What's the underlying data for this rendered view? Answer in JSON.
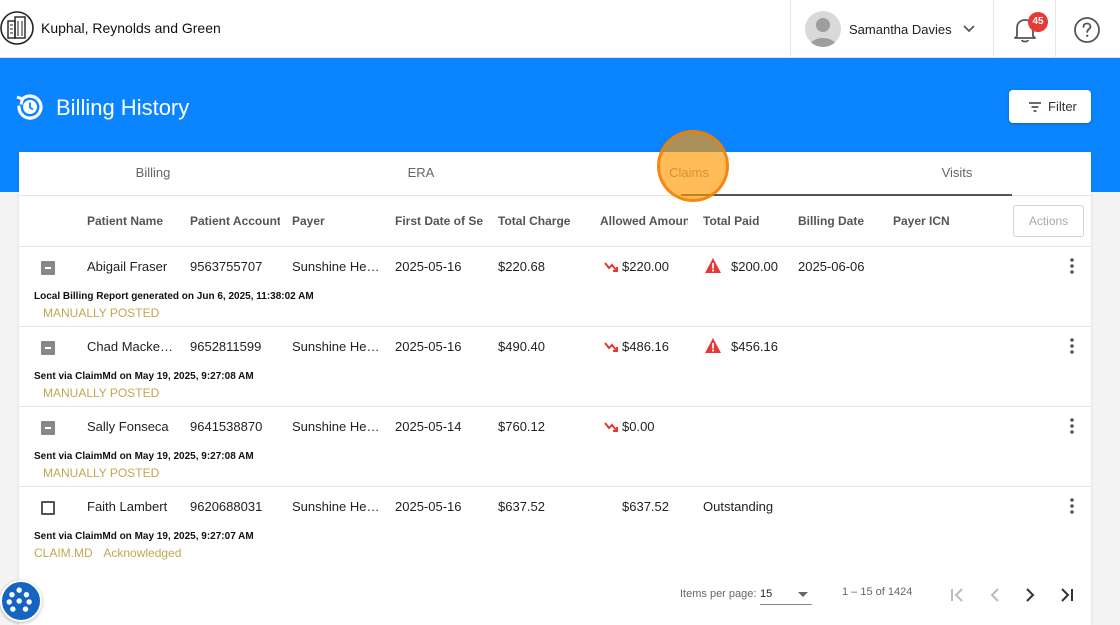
{
  "header": {
    "org_name": "Kuphal, Reynolds and Green",
    "user_name": "Samantha Davies",
    "notification_count": "45"
  },
  "banner": {
    "title": "Billing History",
    "filter_label": "Filter"
  },
  "tabs": [
    {
      "label": "Billing",
      "active": false
    },
    {
      "label": "ERA",
      "active": false
    },
    {
      "label": "Claims",
      "active": true
    },
    {
      "label": "Visits",
      "active": false
    }
  ],
  "table": {
    "columns": [
      "Patient Name",
      "Patient Account",
      "Payer",
      "First Date of Service",
      "Total Charge",
      "Allowed Amount",
      "Total Paid",
      "Billing Date",
      "Payer ICN"
    ],
    "actions_label": "Actions",
    "rows": [
      {
        "checkbox": "indeterminate",
        "patient_name": "Abigail Fraser",
        "patient_account": "9563755707",
        "payer": "Sunshine Health Plan",
        "first_date": "2025-05-16",
        "total_charge": "$220.68",
        "allowed": "$220.00",
        "allowed_trend": "down",
        "total_paid": "$200.00",
        "paid_warning": true,
        "billing_date": "2025-06-06",
        "payer_icn": "",
        "meta": "Local Billing Report generated on Jun 6, 2025, 11:38:02 AM",
        "statuses": [
          "MANUALLY POSTED"
        ]
      },
      {
        "checkbox": "indeterminate",
        "patient_name": "Chad Mackenzie",
        "patient_account": "9652811599",
        "payer": "Sunshine Health Plan",
        "first_date": "2025-05-16",
        "total_charge": "$490.40",
        "allowed": "$486.16",
        "allowed_trend": "down",
        "total_paid": "$456.16",
        "paid_warning": true,
        "billing_date": "",
        "payer_icn": "",
        "meta": "Sent via ClaimMd on May 19, 2025, 9:27:08 AM",
        "statuses": [
          "MANUALLY POSTED"
        ]
      },
      {
        "checkbox": "indeterminate",
        "patient_name": "Sally Fonseca",
        "patient_account": "9641538870",
        "payer": "Sunshine Health Plan",
        "first_date": "2025-05-14",
        "total_charge": "$760.12",
        "allowed": "$0.00",
        "allowed_trend": "down",
        "total_paid": "",
        "paid_warning": false,
        "billing_date": "",
        "payer_icn": "",
        "meta": "Sent via ClaimMd on May 19, 2025, 9:27:08 AM",
        "statuses": [
          "MANUALLY POSTED"
        ]
      },
      {
        "checkbox": "unchecked",
        "patient_name": "Faith Lambert",
        "patient_account": "9620688031",
        "payer": "Sunshine Health Plan",
        "first_date": "2025-05-16",
        "total_charge": "$637.52",
        "allowed": "$637.52",
        "allowed_trend": "",
        "total_paid": "Outstanding",
        "paid_warning": false,
        "billing_date": "",
        "payer_icn": "",
        "meta": "Sent via ClaimMd on May 19, 2025, 9:27:07 AM",
        "statuses": [
          "CLAIM.MD",
          "Acknowledged"
        ]
      }
    ]
  },
  "paginator": {
    "items_label": "Items per page:",
    "page_size": "15",
    "range": "1 – 15 of 1424"
  },
  "colors": {
    "banner": "#0b84ff",
    "status_gold": "#c2a84f",
    "warning_red": "#e53935",
    "badge_red": "#e53935"
  }
}
